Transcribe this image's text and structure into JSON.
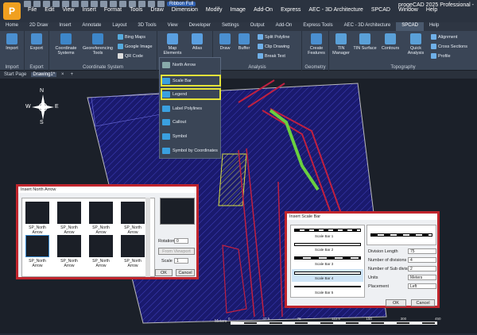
{
  "app": {
    "title": "progeCAD 2025 Professional -",
    "ribbon_selector": "Ribbon Full"
  },
  "menu": [
    "File",
    "Edit",
    "View",
    "Insert",
    "Format",
    "Tools",
    "Draw",
    "Dimension",
    "Modify",
    "Image",
    "Add-On",
    "Express",
    "AEC - 3D Architecture",
    "SPCAD",
    "Window",
    "Help"
  ],
  "tabs": [
    "Home",
    "2D Draw",
    "Insert",
    "Annotate",
    "Layout",
    "3D Tools",
    "View",
    "Developer",
    "Settings",
    "Output",
    "Add-On",
    "Express Tools",
    "AEC - 3D Architecture",
    "SPCAD",
    "Help"
  ],
  "active_tab": "SPCAD",
  "ribbon": {
    "import": {
      "label": "Import",
      "caption": "Import"
    },
    "export": {
      "label": "Export",
      "caption": "Export"
    },
    "coord": {
      "systems": "Coordinate Systems",
      "georef": "Georeferencing Tools",
      "bing": "Bing Maps",
      "google": "Google Image",
      "qr": "QR Code",
      "caption": "Coordinate System"
    },
    "map": {
      "elements": "Map Elements",
      "atlas": "Atlas"
    },
    "analysis": {
      "draw": "Draw",
      "buffer": "Buffer",
      "split": "Split Polyline",
      "clip": "Clip Drawing",
      "break": "Break Text",
      "caption": "Analysis"
    },
    "geometry": {
      "create": "Create Features",
      "caption": "Geometry"
    },
    "topo": {
      "tin_manager": "TIN Manager",
      "tin_surface": "TIN Surface",
      "contours": "Contours",
      "quick": "Quick Analysis",
      "alignment": "Alignment",
      "cross": "Cross Sections",
      "profile": "Profile",
      "caption": "Topography"
    }
  },
  "doc_tabs": [
    "Start Page",
    "Drawing1*"
  ],
  "dropdown": [
    "North Arrow",
    "Scale Bar",
    "Legend",
    "Label Polylines",
    "Callout",
    "Symbol",
    "Symbol by Coordinates"
  ],
  "north_dialog": {
    "title": "Insert North Arrow",
    "items": [
      "SP_North Arrow",
      "SP_North Arrow",
      "SP_North Arrow",
      "SP_North Arrow",
      "SP_North Arrow",
      "SP_North Arrow",
      "SP_North Arrow",
      "SP_North Arrow"
    ],
    "rotation_label": "Rotation",
    "rotation": "0",
    "from_viewport": "From Viewport",
    "scale_label": "Scale",
    "scale": "1",
    "ok": "OK",
    "cancel": "Cancel"
  },
  "scale_dialog": {
    "title": "Insert Scale Bar",
    "bars": [
      "Scale Bar 1",
      "Scale Bar 2",
      "Scale Bar 3",
      "Scale Bar 4",
      "Scale Bar 5"
    ],
    "fields": [
      {
        "label": "Division Length",
        "value": "75"
      },
      {
        "label": "Number of divisions",
        "value": "4"
      },
      {
        "label": "Number of Sub divisions",
        "value": "2"
      },
      {
        "label": "Units",
        "value": "Meters"
      },
      {
        "label": "Placement",
        "value": "Left"
      }
    ],
    "ok": "OK",
    "cancel": "Cancel"
  },
  "compass": {
    "n": "N",
    "s": "S",
    "e": "E",
    "w": "W"
  },
  "bottom_scale": {
    "unit": "Meters",
    "ticks": [
      "0",
      "37.5",
      "75",
      "112.5",
      "150",
      "300",
      "450"
    ]
  },
  "colors": {
    "accent": "#3060b0",
    "highlight": "#e3e23a",
    "dialog_border": "#c0252d",
    "map_fill": "#1a1a6e",
    "roads": "#c02040"
  }
}
